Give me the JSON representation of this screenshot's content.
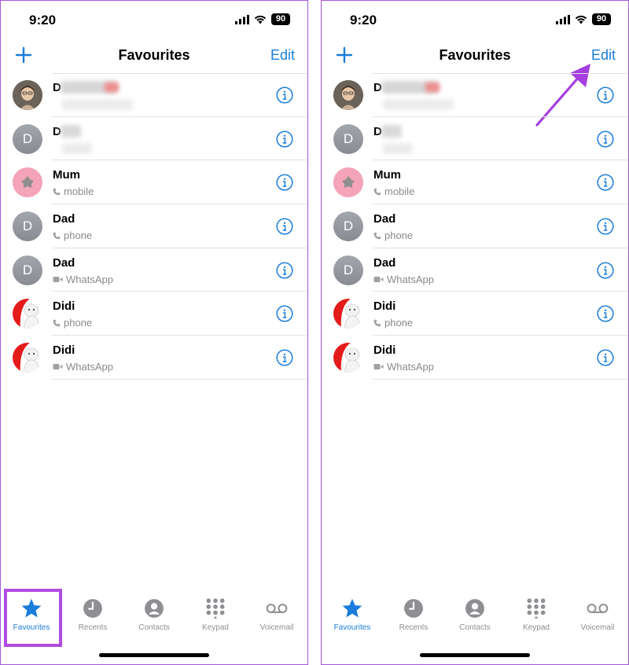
{
  "status": {
    "time": "9:20",
    "battery": "90"
  },
  "nav": {
    "title": "Favourites",
    "edit_label": "Edit"
  },
  "favourites": [
    {
      "name": "D",
      "sub": "",
      "avatar": "photo"
    },
    {
      "name": "D",
      "sub": "",
      "avatar": "D"
    },
    {
      "name": "Mum",
      "sub": "mobile",
      "avatar": "pink",
      "sub_icon": "phone"
    },
    {
      "name": "Dad",
      "sub": "phone",
      "avatar": "D",
      "sub_icon": "phone"
    },
    {
      "name": "Dad",
      "sub": "WhatsApp",
      "avatar": "D",
      "sub_icon": "video"
    },
    {
      "name": "Didi",
      "sub": "phone",
      "avatar": "red",
      "sub_icon": "phone"
    },
    {
      "name": "Didi",
      "sub": "WhatsApp",
      "avatar": "red",
      "sub_icon": "video"
    }
  ],
  "tabs": [
    {
      "label": "Favourites",
      "icon": "star-icon",
      "active": true
    },
    {
      "label": "Recents",
      "icon": "clock-icon"
    },
    {
      "label": "Contacts",
      "icon": "person-icon"
    },
    {
      "label": "Keypad",
      "icon": "keypad-icon"
    },
    {
      "label": "Voicemail",
      "icon": "voicemail-icon"
    }
  ],
  "colors": {
    "accent": "#1a7ddb",
    "highlight": "#b24ce0",
    "frame": "#a259d9"
  }
}
